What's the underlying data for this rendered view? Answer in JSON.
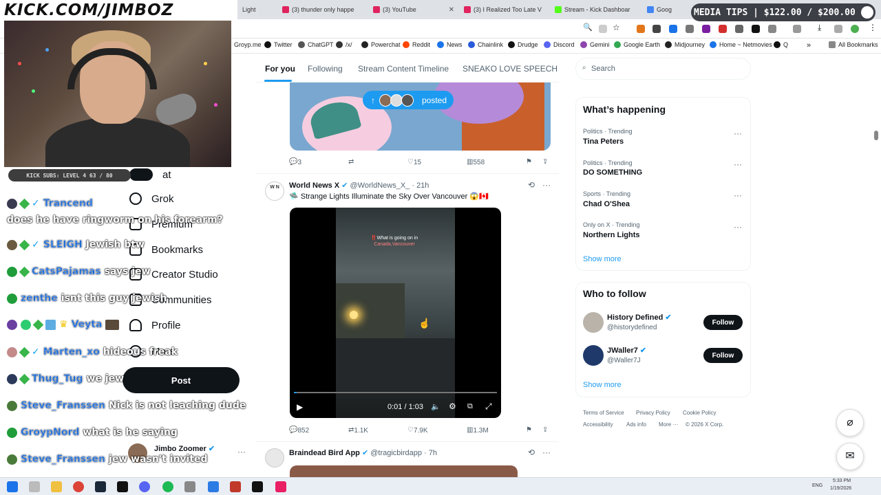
{
  "overlay": {
    "channel_url": "KICK.COM/JIMBOZ",
    "media_tips": "MEDIA TIPS | $122.00 / $200.00",
    "kick_subs": "KICK SUBS: LEVEL 4 63 / 80"
  },
  "browser": {
    "tabs": [
      {
        "label": "Light",
        "color": "#999"
      },
      {
        "label": "(3) thunder only happe",
        "color": "#e0245e"
      },
      {
        "label": "(3) YouTube",
        "color": "#e0245e"
      },
      {
        "label": "(3) I Realized Too Late V",
        "color": "#e0245e"
      },
      {
        "label": "Stream - Kick Dashboar",
        "color": "#53fc18"
      },
      {
        "label": "Goog",
        "color": "#4285f4"
      }
    ],
    "bookmarks": [
      "Groyp.me",
      "Twitter",
      "ChatGPT",
      "/x/",
      "Powerchat",
      "Reddit",
      "News",
      "Chainlink",
      "Drudge",
      "Discord",
      "Gemini",
      "Google Earth",
      "Midjourney",
      "Home ~ Netmovies",
      "Q"
    ],
    "all_bookmarks": "All Bookmarks"
  },
  "chat": [
    {
      "user": "Trancend",
      "msg": ""
    },
    {
      "user": "",
      "msg": "does he have ringworm on his forearm?"
    },
    {
      "user": "SLEIGH",
      "msg": "Jewish btw"
    },
    {
      "user": "CatsPajamas",
      "msg": "says jew"
    },
    {
      "user": "zenthe",
      "msg": "isnt this guy jewish"
    },
    {
      "user": "Veyta",
      "msg": ""
    },
    {
      "user": "Marten_xo",
      "msg": "hideous freak"
    },
    {
      "user": "Thug_Tug",
      "msg": "we jew"
    },
    {
      "user": "Steve_Franssen",
      "msg": "Nick is not leaching dude"
    },
    {
      "user": "GroypNord",
      "msg": "what is he saying"
    },
    {
      "user": "Steve_Franssen",
      "msg": "jew wasn't invited"
    }
  ],
  "x_nav": {
    "items": [
      "at",
      "Grok",
      "Premium",
      "Bookmarks",
      "Creator Studio",
      "Communities",
      "Profile",
      "More"
    ],
    "post": "Post",
    "account_name": "Jimbo Zoomer"
  },
  "feed": {
    "tabs": [
      "For you",
      "Following",
      "Stream Content Timeline",
      "SNEAKO LOVE SPEECH"
    ],
    "posted_pill": "posted",
    "tweet1_actions": {
      "replies": "3",
      "likes": "15",
      "views": "558"
    },
    "tweet2": {
      "name": "World News X",
      "handle": "@WorldNews_X_",
      "time": "· 21h",
      "text": "🛸 Strange Lights Illuminate the Sky Over Vancouver 😱🇨🇦",
      "video_caption_1": "‼️What is going on in",
      "video_caption_2": "Canada,Vancouver",
      "video_time": "0:01 / 1:03",
      "replies": "852",
      "reposts": "1.1K",
      "likes": "7.9K",
      "views": "1.3M"
    },
    "tweet3": {
      "name": "Braindead Bird App",
      "handle": "@tragicbirdapp",
      "time": "· 7h"
    }
  },
  "right": {
    "search_placeholder": "Search",
    "whats_happening": "What’s happening",
    "trends": [
      {
        "category": "Politics · Trending",
        "name": "Tina Peters"
      },
      {
        "category": "Politics · Trending",
        "name": "DO SOMETHING"
      },
      {
        "category": "Sports · Trending",
        "name": "Chad O'Shea"
      },
      {
        "category": "Only on X · Trending",
        "name": "Northern Lights"
      }
    ],
    "show_more": "Show more",
    "who_to_follow": "Who to follow",
    "follow": [
      {
        "name": "History Defined",
        "handle": "@historydefined",
        "button": "Follow"
      },
      {
        "name": "JWaller7",
        "handle": "@Waller7J",
        "button": "Follow"
      }
    ],
    "footer": [
      "Terms of Service",
      "Privacy Policy",
      "Cookie Policy",
      "Accessibility",
      "Ads info",
      "More ···",
      "© 2026 X Corp."
    ]
  },
  "taskbar": {
    "lang": "ENG",
    "time": "5:33 PM",
    "date": "1/19/2026"
  }
}
